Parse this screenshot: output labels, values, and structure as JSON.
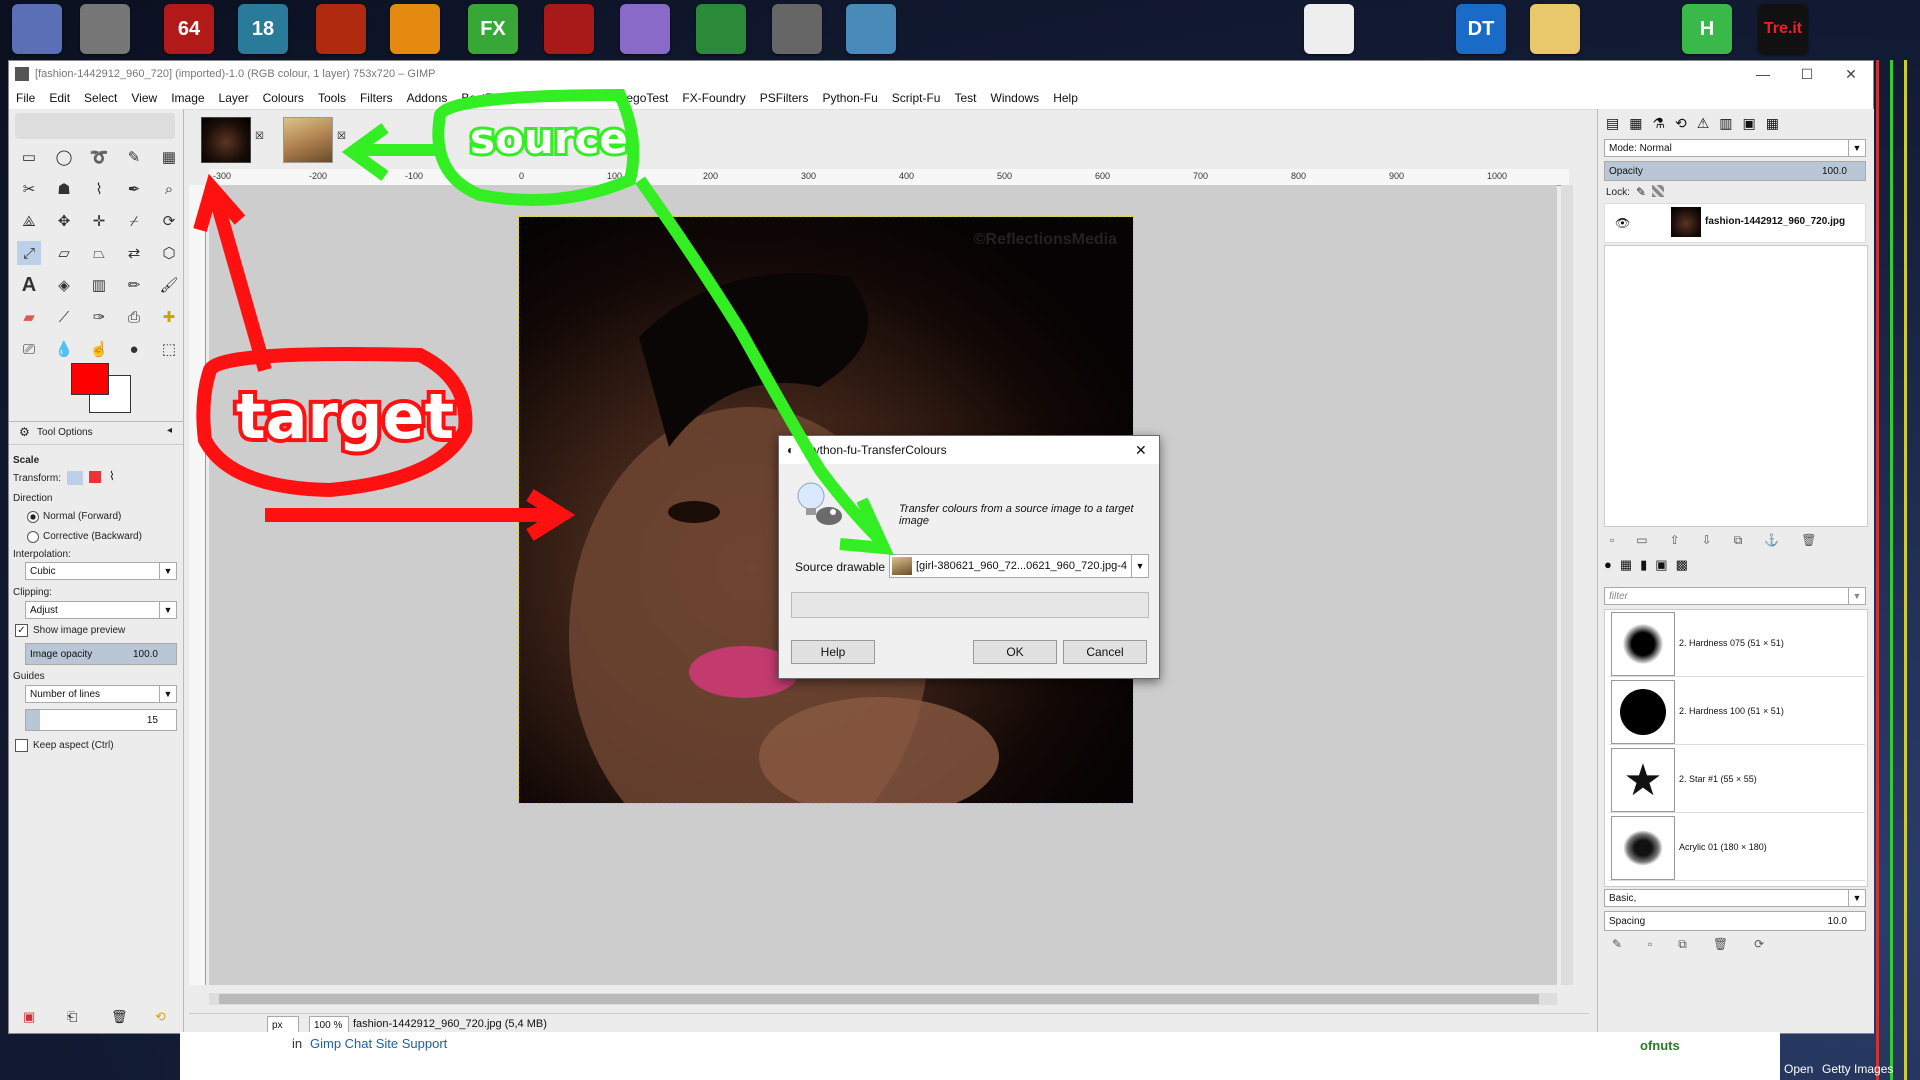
{
  "window": {
    "title": "[fashion-1442912_960_720] (imported)-1.0 (RGB colour, 1 layer) 753x720 – GIMP",
    "minimize": "—",
    "maximize": "☐",
    "close": "✕"
  },
  "desktop": {
    "icons": [
      "",
      "",
      "64",
      "18",
      "",
      "",
      "FX",
      "",
      "",
      "",
      "",
      "",
      "",
      "DT",
      "",
      "H",
      "Tre.it"
    ]
  },
  "menu": [
    "File",
    "Edit",
    "Select",
    "View",
    "Image",
    "Layer",
    "Colours",
    "Tools",
    "Filters",
    "Addons",
    "BestFilters",
    "DiegoTest",
    "FX-Foundry",
    "PSFilters",
    "Python-Fu",
    "Script-Fu",
    "Test",
    "Windows",
    "Help"
  ],
  "tool_options": {
    "header": "Tool Options",
    "tool_name": "Scale",
    "transform_label": "Transform:",
    "direction_label": "Direction",
    "dir_forward": "Normal (Forward)",
    "dir_backward": "Corrective (Backward)",
    "interpolation_label": "Interpolation:",
    "interpolation_value": "Cubic",
    "clipping_label": "Clipping:",
    "clipping_value": "Adjust",
    "show_preview": "Show image preview",
    "opacity_label": "Image opacity",
    "opacity_value": "100.0",
    "guides_label": "Guides",
    "guides_value": "Number of lines",
    "guides_count": "15",
    "keep_aspect": "Keep aspect  (Ctrl)"
  },
  "ruler": {
    "ticks": [
      "-300",
      "-200",
      "-100",
      "0",
      "100",
      "200",
      "300",
      "400",
      "500",
      "600",
      "700",
      "800",
      "900",
      "1000"
    ]
  },
  "image": {
    "watermark": "©ReflectionsMedia"
  },
  "status": {
    "unit": "px",
    "zoom": "100 %",
    "file_info": "fashion-1442912_960_720.jpg (5,4 MB)"
  },
  "layers": {
    "mode_label": "Mode: Normal",
    "opacity_label": "Opacity",
    "opacity_value": "100.0",
    "lock_label": "Lock:",
    "layer_name": "fashion-1442912_960_720.jpg"
  },
  "brushes": {
    "filter_placeholder": "filter",
    "items": [
      {
        "name": "2. Hardness 075 (51 × 51)"
      },
      {
        "name": "2. Hardness 100 (51 × 51)"
      },
      {
        "name": "2. Star #1 (55 × 55)"
      },
      {
        "name": "Acrylic 01 (180 × 180)"
      }
    ],
    "preset": "Basic,",
    "spacing_label": "Spacing",
    "spacing_value": "10.0"
  },
  "dialog": {
    "title": "python-fu-TransferColours",
    "description": "Transfer colours from a source image to a target image",
    "source_label": "Source drawable",
    "source_value": "[girl-380621_960_72...0621_960_720.jpg-4",
    "help": "Help",
    "ok": "OK",
    "cancel": "Cancel"
  },
  "annotations": {
    "source": "source",
    "target": "target",
    "colors": {
      "green": "#33ee22",
      "red": "#ff1111"
    }
  },
  "background_page": {
    "link_prefix": "in",
    "link_text": "Gimp Chat Site Support",
    "author": "ofnuts",
    "open": "Open",
    "getty": "Getty Images"
  }
}
